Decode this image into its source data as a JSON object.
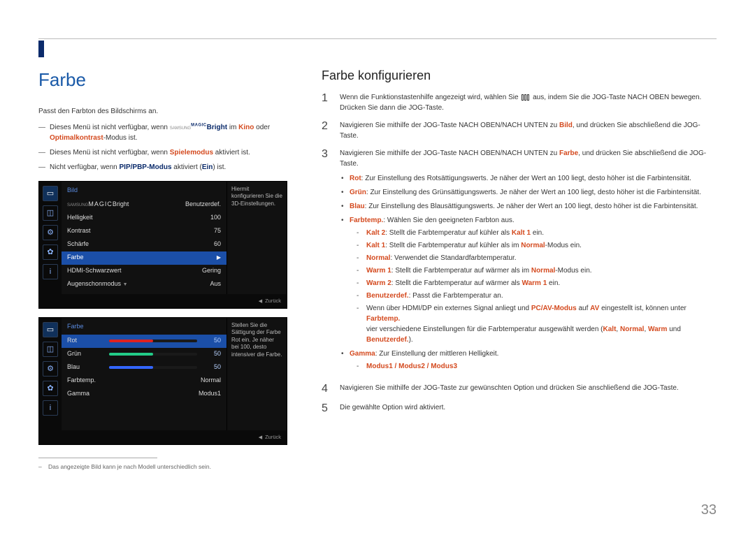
{
  "page_number": "33",
  "left": {
    "h1": "Farbe",
    "intro": "Passt den Farbton des Bildschirms an.",
    "note1_a": "Dieses Menü ist nicht verfügbar, wenn ",
    "note1_magic_sup": "SAMSUNG",
    "note1_magic": "MAGIC",
    "note1_b": "Bright",
    "note1_c": " im ",
    "note1_d": "Kino",
    "note1_e": " oder ",
    "note1_f": "Optimalkontrast",
    "note1_g": "-Modus ist.",
    "note2_a": "Dieses Menü ist nicht verfügbar, wenn ",
    "note2_b": "Spielemodus",
    "note2_c": " aktiviert ist.",
    "note3_a": "Nicht verfügbar, wenn ",
    "note3_b": "PIP/PBP-Modus",
    "note3_c": " aktiviert (",
    "note3_d": "Ein",
    "note3_e": ") ist.",
    "footnote": "Das angezeigte Bild kann je nach Modell unterschiedlich sein."
  },
  "osd1": {
    "title": "Bild",
    "rows": {
      "r1_label": "Bright",
      "r1_pretty_sup": "SAMSUNG",
      "r1_pretty": "MAGIC",
      "r1_val": "Benutzerdef.",
      "r2_label": "Helligkeit",
      "r2_val": "100",
      "r3_label": "Kontrast",
      "r3_val": "75",
      "r4_label": "Schärfe",
      "r4_val": "60",
      "r5_label": "Farbe",
      "r6_label": "HDMI-Schwarzwert",
      "r6_val": "Gering",
      "r7_label": "Augenschonmodus",
      "r7_val": "Aus"
    },
    "help": "Hiermit konfigurieren Sie die 3D-Einstellungen.",
    "back": "Zurück"
  },
  "osd2": {
    "title": "Farbe",
    "rows": {
      "r1_label": "Rot",
      "r1_val": "50",
      "r2_label": "Grün",
      "r2_val": "50",
      "r3_label": "Blau",
      "r3_val": "50",
      "r4_label": "Farbtemp.",
      "r4_val": "Normal",
      "r5_label": "Gamma",
      "r5_val": "Modus1"
    },
    "help": "Stellen Sie die Sättigung der Farbe Rot ein. Je näher bei 100, desto intensiver die Farbe.",
    "back": "Zurück"
  },
  "right": {
    "h2": "Farbe konfigurieren",
    "s1a": "Wenn die Funktionstastenhilfe angezeigt wird, wählen Sie ",
    "s1b": " aus, indem Sie die JOG-Taste NACH OBEN bewegen.",
    "s1c": "Drücken Sie dann die JOG-Taste.",
    "s2a": "Navigieren Sie mithilfe der JOG-Taste NACH OBEN/NACH UNTEN zu ",
    "s2b": "Bild",
    "s2c": ", und drücken Sie abschließend die JOG-Taste.",
    "s3a": "Navigieren Sie mithilfe der JOG-Taste NACH OBEN/NACH UNTEN zu ",
    "s3b": "Farbe",
    "s3c": ", und drücken Sie abschließend die JOG-Taste.",
    "b_rot_k": "Rot",
    "b_rot_v": ": Zur Einstellung des Rotsättigungswerts. Je näher der Wert an 100 liegt, desto höher ist die Farbintensität.",
    "b_gruen_k": "Grün",
    "b_gruen_v": ": Zur Einstellung des Grünsättigungswerts. Je näher der Wert an 100 liegt, desto höher ist die Farbintensität.",
    "b_blau_k": "Blau",
    "b_blau_v": ": Zur Einstellung des Blausättigungswerts. Je näher der Wert an 100 liegt, desto höher ist die Farbintensität.",
    "b_ft_k": "Farbtemp.",
    "b_ft_v": ": Wählen Sie den geeigneten Farbton aus.",
    "ft_kalt2_k": "Kalt 2",
    "ft_kalt2_a": ": Stellt die Farbtemperatur auf kühler als ",
    "ft_kalt2_b": "Kalt 1",
    "ft_kalt2_c": " ein.",
    "ft_kalt1_k": "Kalt 1",
    "ft_kalt1_a": ": Stellt die Farbtemperatur auf kühler als im ",
    "ft_kalt1_b": "Normal",
    "ft_kalt1_c": "-Modus ein.",
    "ft_norm_k": "Normal",
    "ft_norm_a": ": Verwendet die Standardfarbtemperatur.",
    "ft_warm1_k": "Warm 1",
    "ft_warm1_a": ": Stellt die Farbtemperatur auf wärmer als im ",
    "ft_warm1_b": "Normal",
    "ft_warm1_c": "-Modus ein.",
    "ft_warm2_k": "Warm 2",
    "ft_warm2_a": ": Stellt die Farbtemperatur auf wärmer als ",
    "ft_warm2_b": "Warm 1",
    "ft_warm2_c": " ein.",
    "ft_ben_k": "Benutzerdef.",
    "ft_ben_a": ": Passt die Farbtemperatur an.",
    "ft_note_a": "Wenn über HDMI/DP ein externes Signal anliegt und ",
    "ft_note_b": "PC/AV-Modus",
    "ft_note_c": " auf ",
    "ft_note_d": "AV",
    "ft_note_e": " eingestellt ist, können unter ",
    "ft_note_f": "Farbtemp.",
    "ft_note_g": " vier verschiedene Einstellungen für die Farbtemperatur ausgewählt werden (",
    "ft_note_h": "Kalt",
    "ft_note_i": ", ",
    "ft_note_j": "Normal",
    "ft_note_k": ", ",
    "ft_note_l": "Warm",
    "ft_note_m": " und ",
    "ft_note_n": "Benutzerdef.",
    "ft_note_o": ").",
    "b_gamma_k": "Gamma",
    "b_gamma_v": ": Zur Einstellung der mittleren Helligkeit.",
    "gamma_modes": "Modus1 / Modus2 / Modus3",
    "s4": "Navigieren Sie mithilfe der JOG-Taste zur gewünschten Option und drücken Sie anschließend die JOG-Taste.",
    "s5": "Die gewählte Option wird aktiviert."
  }
}
